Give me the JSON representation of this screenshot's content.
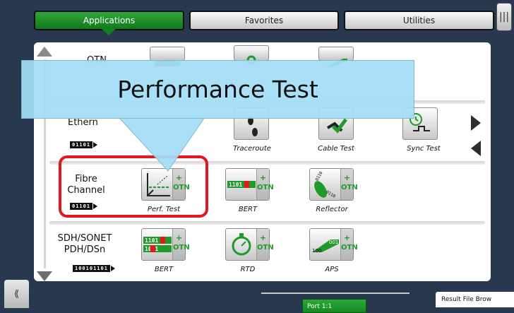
{
  "tabs": [
    {
      "label": "Applications",
      "active": true
    },
    {
      "label": "Favorites",
      "active": false
    },
    {
      "label": "Utilities",
      "active": false
    }
  ],
  "side_grip_icon": "menu-bars-icon",
  "callout": {
    "text": "Performance Test"
  },
  "categories": [
    {
      "label": "OTN",
      "bits": ""
    },
    {
      "label": "Ethern",
      "bits": "01101"
    },
    {
      "label": "Fibre\nChannel",
      "bits": "01101"
    },
    {
      "label": "SDH/SONET\nPDH/DSn",
      "bits": "100101101"
    }
  ],
  "ethernet_apps": [
    {
      "label": "Traceroute",
      "icon": "footprints-icon"
    },
    {
      "label": "Cable Test",
      "icon": "cable-test-icon"
    },
    {
      "label": "Sync Test",
      "icon": "clock-wave-icon"
    }
  ],
  "fibre_apps": [
    {
      "label": "Perf. Test",
      "icon": "performance-graph-icon",
      "otn": "OTN"
    },
    {
      "label": "BERT",
      "icon": "bit-error-icon",
      "otn": "OTN"
    },
    {
      "label": "Reflector",
      "icon": "reflector-icon",
      "otn": "OTN"
    }
  ],
  "sdh_apps": [
    {
      "label": "BERT",
      "icon": "bit-error-icon",
      "otn": "OTN"
    },
    {
      "label": "RTD",
      "icon": "stopwatch-icon",
      "otn": "OTN"
    },
    {
      "label": "APS",
      "icon": "aps-switch-icon",
      "otn": "OTN"
    }
  ],
  "bottom": {
    "port_label": "Port 1:1",
    "result_label": "Result File Brow",
    "left_button_icon": "chevrons-left-icon"
  },
  "colors": {
    "accent_green": "#1f9a2b",
    "highlight_red": "#e4161e",
    "callout_blue": "#a2def6"
  }
}
